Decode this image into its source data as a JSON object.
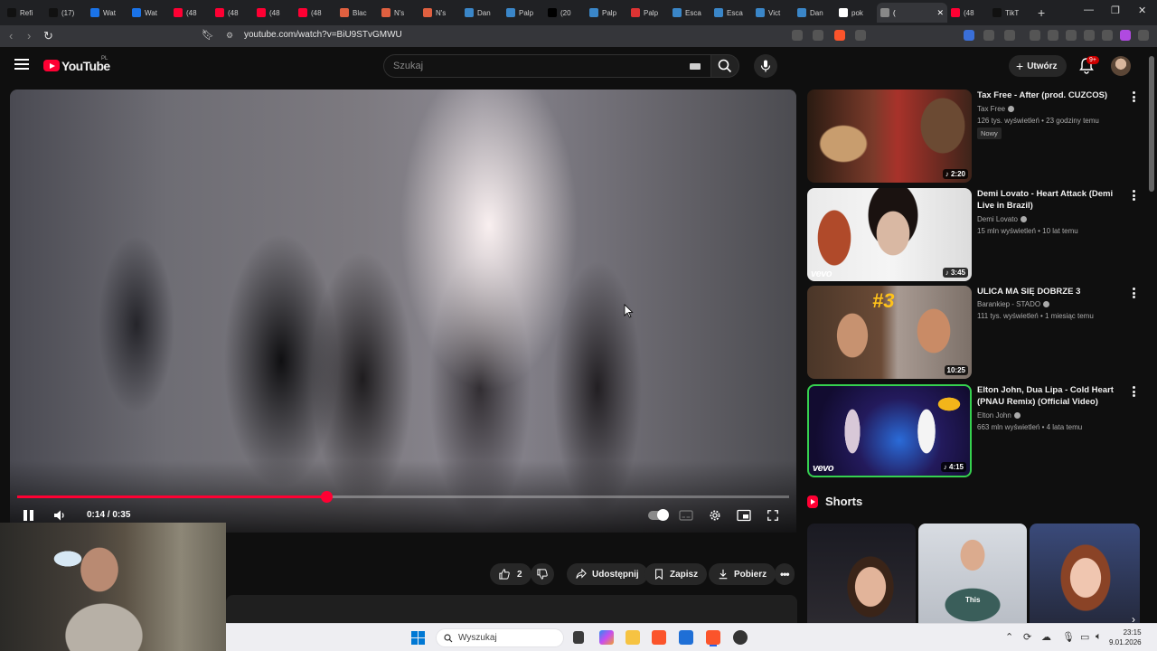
{
  "browser": {
    "tabs": [
      {
        "label": "Refi",
        "favicon": "tiktok-icon",
        "color": "#111111"
      },
      {
        "label": "(17)",
        "favicon": "tiktok-icon",
        "color": "#111111"
      },
      {
        "label": "Wat",
        "favicon": "web-icon",
        "color": "#1a73e8"
      },
      {
        "label": "Wat",
        "favicon": "web-icon",
        "color": "#1a73e8"
      },
      {
        "label": "(48",
        "favicon": "youtube-icon",
        "color": "#ff0033"
      },
      {
        "label": "(48",
        "favicon": "youtube-icon",
        "color": "#ff0033"
      },
      {
        "label": "(48",
        "favicon": "youtube-icon",
        "color": "#ff0033"
      },
      {
        "label": "(48",
        "favicon": "youtube-icon",
        "color": "#ff0033"
      },
      {
        "label": "Blac",
        "favicon": "chess-icon",
        "color": "#e06040"
      },
      {
        "label": "N's",
        "favicon": "chess-icon",
        "color": "#e06040"
      },
      {
        "label": "N's",
        "favicon": "chess-icon",
        "color": "#e06040"
      },
      {
        "label": "Dan",
        "favicon": "wiki-icon",
        "color": "#3a86c8"
      },
      {
        "label": "Palp",
        "favicon": "wiki-icon",
        "color": "#3a86c8"
      },
      {
        "label": "(20",
        "favicon": "x-icon",
        "color": "#000000"
      },
      {
        "label": "Palp",
        "favicon": "wiki-icon",
        "color": "#3a86c8"
      },
      {
        "label": "Palp",
        "favicon": "flag-icon",
        "color": "#d33"
      },
      {
        "label": "Esca",
        "favicon": "wiki-icon",
        "color": "#3a86c8"
      },
      {
        "label": "Esca",
        "favicon": "wiki-icon",
        "color": "#3a86c8"
      },
      {
        "label": "Vict",
        "favicon": "wiki-icon",
        "color": "#3a86c8"
      },
      {
        "label": "Dan",
        "favicon": "wiki-icon",
        "color": "#3a86c8"
      },
      {
        "label": "pok",
        "favicon": "google-icon",
        "color": "#ffffff"
      }
    ],
    "active_tab": {
      "label": "(",
      "favicon": "speaker-icon"
    },
    "after_tabs": [
      {
        "label": "(48",
        "favicon": "youtube-icon",
        "color": "#ff0033"
      },
      {
        "label": "TikT",
        "favicon": "tiktok-icon",
        "color": "#111111"
      }
    ],
    "url": "youtube.com/watch?v=BiU9STvGMWU",
    "brave_badge": "1"
  },
  "youtube": {
    "logo_text": "YouTube",
    "country_code": "PL",
    "search_placeholder": "Szukaj",
    "create_label": "Utwórz",
    "notifications_badge": "9+",
    "accent_color": "#ff0033"
  },
  "player": {
    "time_current": "0:14",
    "time_separator": "/",
    "time_total": "0:35",
    "progress_fraction": 0.4,
    "state": "playing",
    "autoplay": true
  },
  "actions": {
    "like_count": "2",
    "share_label": "Udostępnij",
    "save_label": "Zapisz",
    "download_label": "Pobierz"
  },
  "recommendations": [
    {
      "title": "Tax Free - After (prod. CUZCOS)",
      "channel": "Tax Free",
      "meta": "126 tys. wyświetleń • 23 godziny temu",
      "badge": "Nowy",
      "duration": "2:20",
      "vevo": false
    },
    {
      "title": "Demi Lovato - Heart Attack (Demi Live in Brazil)",
      "channel": "Demi Lovato",
      "meta": "15 mln wyświetleń • 10 lat temu",
      "badge": "",
      "duration": "3:45",
      "vevo": true
    },
    {
      "title": "ULICA MA SIĘ DOBRZE 3",
      "channel": "Barankiep - STADO",
      "meta": "111 tys. wyświetleń • 1 miesiąc temu",
      "badge": "",
      "duration": "10:25",
      "vevo": false
    },
    {
      "title": "Elton John, Dua Lipa - Cold Heart (PNAU Remix) (Official Video)",
      "channel": "Elton John",
      "meta": "663 mln wyświetleń • 4 lata temu",
      "badge": "",
      "duration": "4:15",
      "vevo": true
    }
  ],
  "thumb_overlay": {
    "badge_3": "#3"
  },
  "vevo_label": "vevo",
  "shorts": {
    "label": "Shorts",
    "items": [
      {
        "caption": ""
      },
      {
        "caption": "This"
      },
      {
        "caption": ""
      }
    ]
  },
  "taskbar": {
    "search_placeholder": "Wyszukaj",
    "time": "23:15",
    "date": "9.01.2026"
  }
}
